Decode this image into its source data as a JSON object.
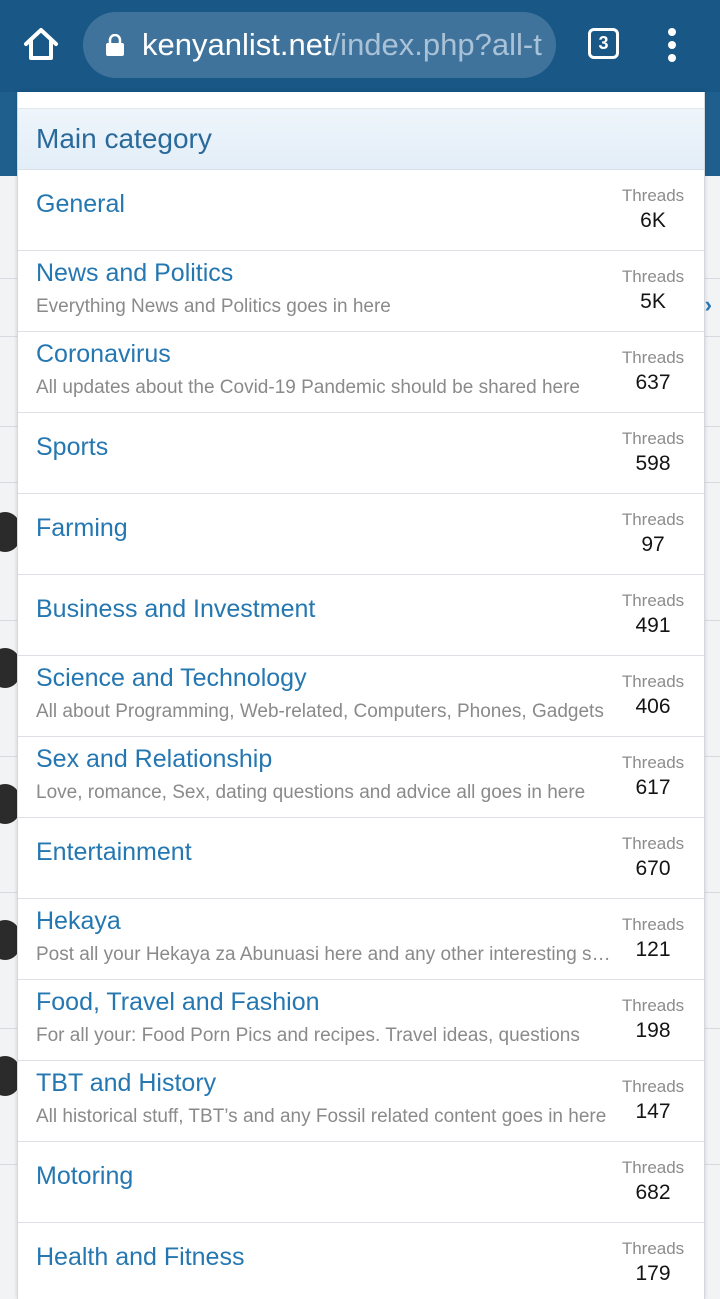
{
  "browser": {
    "url_domain": "kenyanlist.net",
    "url_path": "/index.php?all-t",
    "tab_count": "3",
    "home_icon": "home-icon",
    "lock_icon": "lock-icon",
    "menu_icon": "more-vert-icon",
    "bar_color": "#185786"
  },
  "menu": {
    "section_title": "Main category",
    "stat_label": "Threads",
    "nodes": [
      {
        "title": "General",
        "desc": "",
        "threads": "6K"
      },
      {
        "title": "News and Politics",
        "desc": "Everything News and Politics goes in here",
        "threads": "5K"
      },
      {
        "title": "Coronavirus",
        "desc": "All updates about the Covid-19 Pandemic should be shared here",
        "threads": "637"
      },
      {
        "title": "Sports",
        "desc": "",
        "threads": "598"
      },
      {
        "title": "Farming",
        "desc": "",
        "threads": "97"
      },
      {
        "title": "Business and Investment",
        "desc": "",
        "threads": "491"
      },
      {
        "title": "Science and Technology",
        "desc": "All about Programming, Web-related, Computers, Phones, Gadgets",
        "threads": "406"
      },
      {
        "title": "Sex and Relationship",
        "desc": "Love, romance, Sex, dating questions and advice all goes in here",
        "threads": "617"
      },
      {
        "title": "Entertainment",
        "desc": "",
        "threads": "670"
      },
      {
        "title": "Hekaya",
        "desc": "Post all your Hekaya za Abunuasi here and any other interesting stories",
        "threads": "121"
      },
      {
        "title": "Food, Travel and Fashion",
        "desc": "For all your: Food Porn Pics and recipes. Travel ideas, questions",
        "threads": "198"
      },
      {
        "title": "TBT and History",
        "desc": "All historical stuff, TBT’s and any Fossil related content goes in here",
        "threads": "147"
      },
      {
        "title": "Motoring",
        "desc": "",
        "threads": "682"
      },
      {
        "title": "Health and Fitness",
        "desc": "",
        "threads": "179"
      }
    ]
  }
}
